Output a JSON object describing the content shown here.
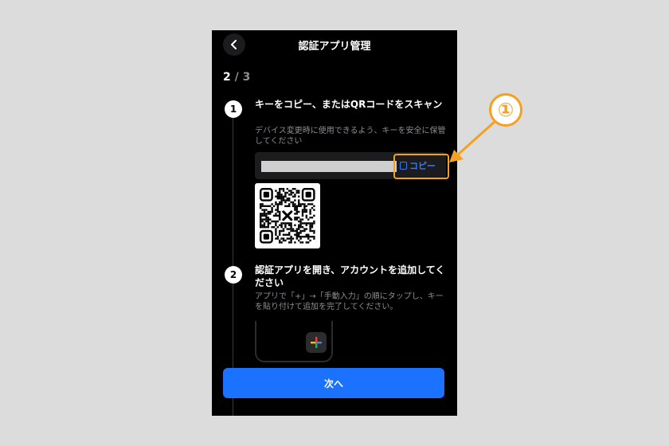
{
  "header": {
    "title": "認証アプリ管理"
  },
  "progress": {
    "current": "2",
    "separator": " / ",
    "total": "3"
  },
  "step1": {
    "number": "1",
    "title": "キーをコピー、またはQRコードをスキャン",
    "description": "デバイス変更時に使用できるよう、キーを安全に保管してください",
    "copy_label": "コピー"
  },
  "step2": {
    "number": "2",
    "title": "認証アプリを開き、アカウントを追加してください",
    "description": "アプリで「+」→「手動入力」の順にタップし、キーを貼り付けて追加を完了してください。"
  },
  "footer": {
    "next_label": "次へ"
  },
  "annotation": {
    "marker": "①"
  },
  "colors": {
    "accent": "#1a72ff",
    "annotation": "#f5a020"
  },
  "icons": {
    "back": "chevron-left-icon",
    "copy": "copy-icon",
    "plus": "plus-icon"
  }
}
